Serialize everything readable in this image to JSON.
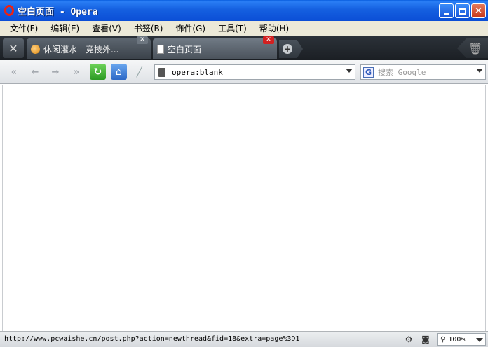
{
  "window": {
    "title": "空白页面 - Opera",
    "controls": [
      "minimize-icon",
      "maximize-icon",
      "close-icon"
    ]
  },
  "menu": {
    "items": [
      "文件(F)",
      "编辑(E)",
      "查看(V)",
      "书签(B)",
      "饰件(G)",
      "工具(T)",
      "帮助(H)"
    ]
  },
  "tabs": [
    {
      "label": "休闲灌水 - 竞技外...",
      "active": false,
      "icon": "orange-bulb-icon"
    },
    {
      "label": "空白页面",
      "active": true,
      "icon": "page-icon"
    }
  ],
  "toolbar": {
    "address_value": "opera:blank",
    "search_placeholder": "搜索 Google",
    "search_engine_icon": "G"
  },
  "status": {
    "url": "http://www.pcwaishe.cn/post.php?action=newthread&fid=18&extra=page%3D1",
    "zoom": "100%"
  },
  "colors": {
    "titlebar": "#1560e0",
    "active_tab_close": "#d32020",
    "reload": "#2c9a23",
    "home": "#2d68c6"
  }
}
